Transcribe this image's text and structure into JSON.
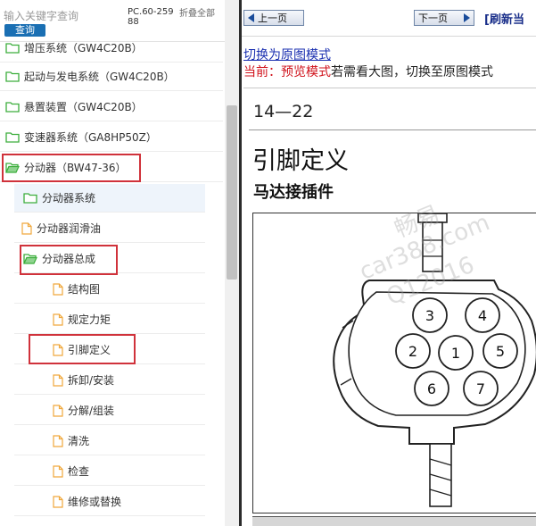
{
  "search": {
    "placeholder": "输入关键字查询",
    "button_label": "查询"
  },
  "header": {
    "pc_label": "PC.60-25988",
    "fold_label": "折叠全部"
  },
  "tree": {
    "items": [
      {
        "label": "增压系统（GW4C20B）",
        "icon": "folder-icon"
      },
      {
        "label": "起动与发电系统（GW4C20B）",
        "icon": "folder-icon"
      },
      {
        "label": "悬置装置（GW4C20B）",
        "icon": "folder-icon"
      },
      {
        "label": "变速器系统（GA8HP50Z）",
        "icon": "folder-icon"
      },
      {
        "label": "分动器（BW47-36）",
        "icon": "folder-open-icon"
      },
      {
        "label": "分动器系统",
        "icon": "folder-icon"
      },
      {
        "label": "分动器润滑油",
        "icon": "document-icon"
      },
      {
        "label": "分动器总成",
        "icon": "folder-open-icon"
      },
      {
        "label": "结构图",
        "icon": "document-icon"
      },
      {
        "label": "规定力矩",
        "icon": "document-icon"
      },
      {
        "label": "引脚定义",
        "icon": "document-icon"
      },
      {
        "label": "拆卸/安装",
        "icon": "document-icon"
      },
      {
        "label": "分解/组装",
        "icon": "document-icon"
      },
      {
        "label": "清洗",
        "icon": "document-icon"
      },
      {
        "label": "检查",
        "icon": "document-icon"
      },
      {
        "label": "维修或替换",
        "icon": "document-icon"
      }
    ]
  },
  "nav": {
    "prev_label": "上一页",
    "next_label": "下一页",
    "refresh_label": "[刷新当"
  },
  "mode": {
    "switch_link": "切换为原图模式",
    "current_prefix": "当前：",
    "current_mode": "预览模式",
    "hint": "若需看大图，切换至原图模式"
  },
  "doc": {
    "page_number": "14—22",
    "title": "引脚定义",
    "subtitle": "马达接插件",
    "watermark_lines": [
      "畅易",
      "car388.com",
      "Q12016"
    ]
  },
  "connector": {
    "pins": [
      "1",
      "2",
      "3",
      "4",
      "5",
      "6",
      "7"
    ]
  },
  "colors": {
    "accent": "#1a6fb3",
    "highlight": "#d0323b",
    "folder": "#3cae3c",
    "document": "#f0a83c",
    "mode_red": "#d0121b",
    "link_blue": "#1a2fb0"
  }
}
